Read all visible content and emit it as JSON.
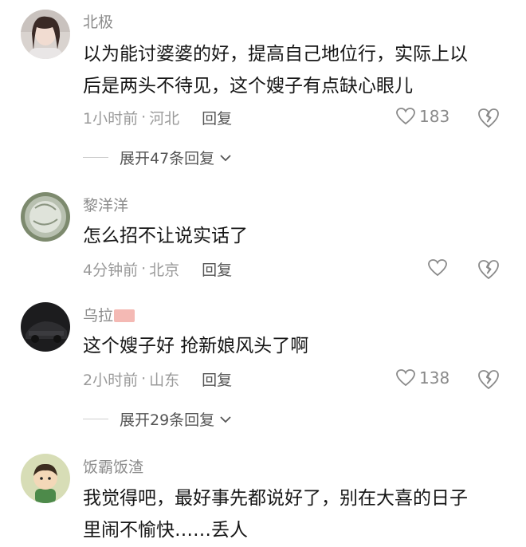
{
  "comments": [
    {
      "username": "北极",
      "text_lines": [
        "以为能讨婆婆的好，提高自己地位行，实际上以",
        "后是两头不待见，这个嫂子有点缺心眼儿"
      ],
      "time": "1小时前",
      "location": "河北",
      "reply_label": "回复",
      "likes": "183",
      "expand_label": "展开47条回复"
    },
    {
      "username": "黎洋洋",
      "text_lines": [
        "怎么招不让说实话了"
      ],
      "time": "4分钟前",
      "location": "北京",
      "reply_label": "回复",
      "likes": ""
    },
    {
      "username": "乌拉",
      "text_lines": [
        "这个嫂子好 抢新娘风头了啊"
      ],
      "time": "2小时前",
      "location": "山东",
      "reply_label": "回复",
      "likes": "138",
      "expand_label": "展开29条回复"
    },
    {
      "username": "饭霸饭渣",
      "text_lines": [
        "我觉得吧，最好事先都说好了，别在大喜的日子",
        "里闹不愉快……丢人"
      ]
    }
  ],
  "meta_separator": "·",
  "colors": {
    "meta": "#9a9a9a",
    "username": "#8c8c8c",
    "text": "#161616"
  }
}
